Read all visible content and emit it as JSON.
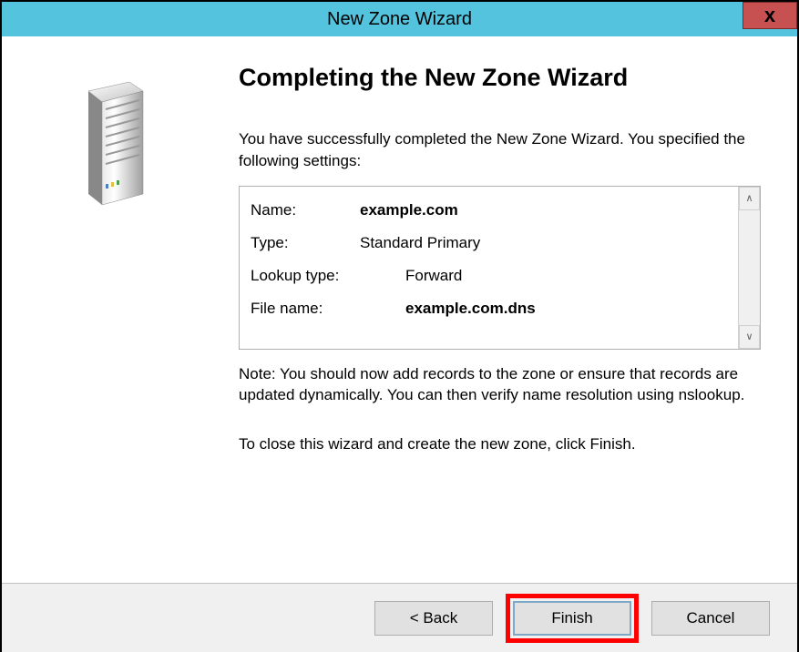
{
  "titlebar": {
    "title": "New Zone Wizard",
    "close_glyph": "x"
  },
  "heading": "Completing the New Zone Wizard",
  "intro": "You have successfully completed the New Zone Wizard. You specified the following settings:",
  "settings": {
    "name_label": "Name:",
    "name_value": "example.com",
    "type_label": "Type:",
    "type_value": "Standard Primary",
    "lookup_label": "Lookup type:",
    "lookup_value": "Forward",
    "file_label": "File name:",
    "file_value": "example.com.dns"
  },
  "note": "Note: You should now add records to the zone or ensure that records are updated dynamically. You can then verify name resolution using nslookup.",
  "close_instruction": "To close this wizard and create the new zone, click Finish.",
  "buttons": {
    "back": "< Back",
    "finish": "Finish",
    "cancel": "Cancel"
  },
  "scroll": {
    "up": "∧",
    "down": "∨"
  }
}
